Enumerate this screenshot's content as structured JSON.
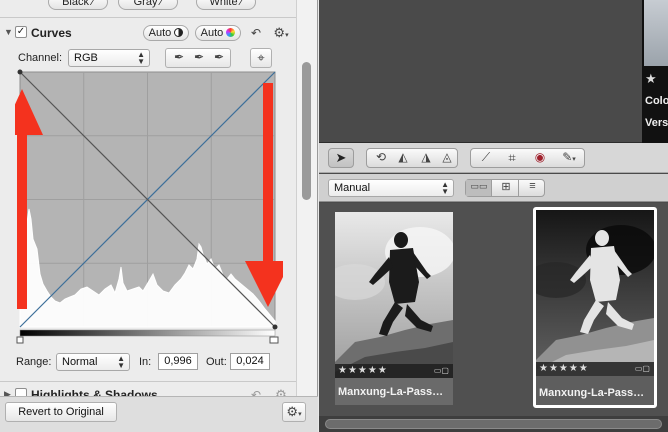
{
  "levels_buttons": {
    "black": "Black",
    "gray": "Gray",
    "white": "White"
  },
  "curves": {
    "title": "Curves",
    "auto_1": "Auto",
    "auto_2": "Auto",
    "channel_label": "Channel:",
    "channel_value": "RGB",
    "range_label": "Range:",
    "range_value": "Normal",
    "in_label": "In:",
    "in_value": "0,996",
    "out_label": "Out:",
    "out_value": "0,024"
  },
  "next_section": {
    "title": "Highlights & Shadows"
  },
  "footer": {
    "revert_label": "Revert to Original"
  },
  "metadata_panel": {
    "stars": "★ ",
    "color_label": "Colo",
    "version_label": "Vers"
  },
  "browser": {
    "sort_value": "Manual",
    "thumbnails": [
      {
        "name": "Manxung-La-Pass…",
        "stars": "★★★★★",
        "selected": false
      },
      {
        "name": "Manxung-La-Pass…",
        "stars": "★★★★★",
        "selected": true
      }
    ]
  },
  "colors": {
    "accent_arrow": "#f4321e",
    "selection_border": "#ffffff",
    "panel_bg": "#ececec",
    "browser_bg": "#4a4a4a"
  }
}
